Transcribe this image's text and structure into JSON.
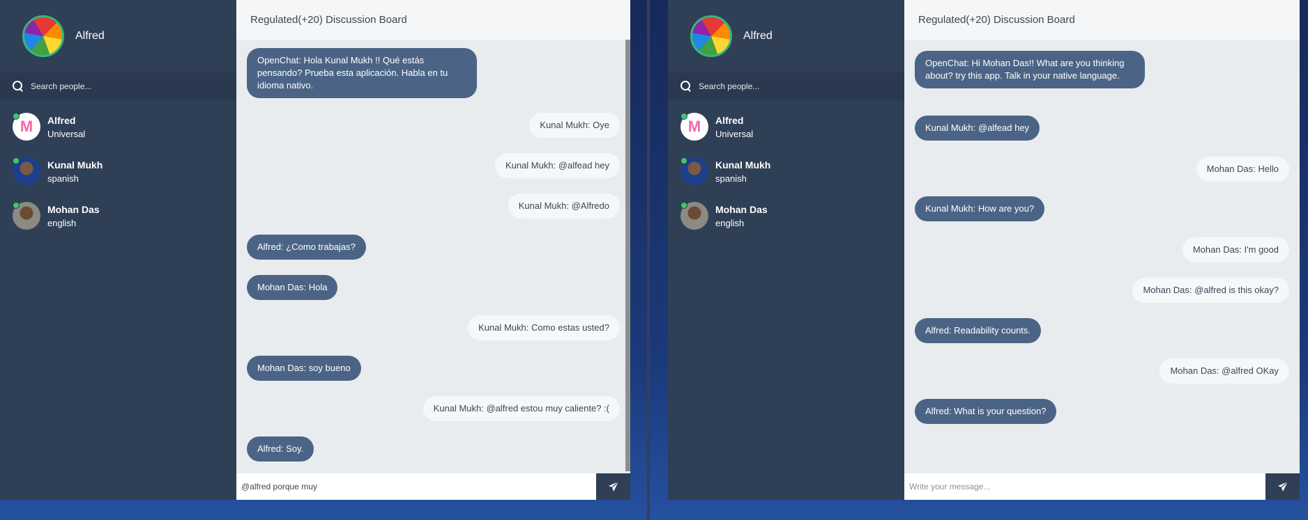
{
  "left_app": {
    "profile": {
      "name": "Alfred"
    },
    "search": {
      "placeholder": "Search people..."
    },
    "contacts": [
      {
        "name": "Alfred",
        "language": "Universal"
      },
      {
        "name": "Kunal Mukh",
        "language": "spanish"
      },
      {
        "name": "Mohan Das",
        "language": "english"
      }
    ],
    "chat": {
      "title": "Regulated(+20) Discussion Board",
      "messages": [
        {
          "text": "OpenChat: Hola Kunal Mukh !! Qué estás pensando? Prueba esta aplicación. Habla en tu idioma nativo.",
          "direction": "in"
        },
        {
          "text": "Kunal Mukh: Oye",
          "direction": "out"
        },
        {
          "text": "Kunal Mukh: @alfead hey",
          "direction": "out"
        },
        {
          "text": "Kunal Mukh: @Alfredo",
          "direction": "out"
        },
        {
          "text": "Alfred: ¿Como trabajas?",
          "direction": "in"
        },
        {
          "text": "Mohan Das: Hola",
          "direction": "in"
        },
        {
          "text": "Kunal Mukh: Como estas usted?",
          "direction": "out"
        },
        {
          "text": "Mohan Das: soy bueno",
          "direction": "in"
        },
        {
          "text": "Kunal Mukh: @alfred estou muy caliente? :(",
          "direction": "out"
        },
        {
          "text": "Alfred: Soy.",
          "direction": "in"
        }
      ],
      "composer_value": "@alfred porque muy "
    }
  },
  "right_app": {
    "profile": {
      "name": "Alfred"
    },
    "search": {
      "placeholder": "Search people..."
    },
    "contacts": [
      {
        "name": "Alfred",
        "language": "Universal"
      },
      {
        "name": "Kunal Mukh",
        "language": "spanish"
      },
      {
        "name": "Mohan Das",
        "language": "english"
      }
    ],
    "chat": {
      "title": "Regulated(+20) Discussion Board",
      "messages": [
        {
          "text": "OpenChat: Hi Mohan Das!! What are you thinking about? try this app. Talk in your native language.",
          "direction": "in"
        },
        {
          "text": "Kunal Mukh: @alfead hey",
          "direction": "in"
        },
        {
          "text": "Mohan Das: Hello",
          "direction": "out"
        },
        {
          "text": "Kunal Mukh: How are you?",
          "direction": "in"
        },
        {
          "text": "Mohan Das: I'm good",
          "direction": "out"
        },
        {
          "text": "Mohan Das: @alfred is this okay?",
          "direction": "out"
        },
        {
          "text": "Alfred: Readability counts.",
          "direction": "in"
        },
        {
          "text": "Mohan Das: @alfred OKay",
          "direction": "out"
        },
        {
          "text": "Alfred: What is your question?",
          "direction": "in"
        }
      ],
      "composer_placeholder": "Write your message..."
    }
  },
  "icons": {
    "search": "search-icon",
    "send": "send-icon",
    "online": "online-dot-icon"
  },
  "colors": {
    "sidebar": "#2f3f56",
    "incoming_bubble": "#4b6486",
    "outgoing_bubble": "#f6f7f8",
    "chat_bg": "#e9ecef",
    "online": "#3cc76a"
  }
}
